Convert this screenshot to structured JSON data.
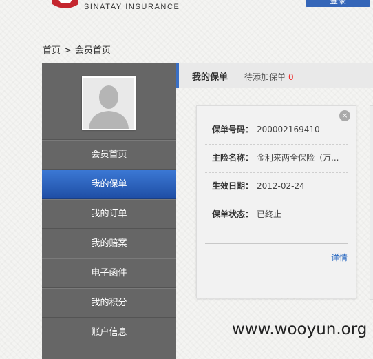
{
  "header": {
    "brand_en": "SINATAY INSURANCE",
    "login_label": "登录"
  },
  "breadcrumb": {
    "items": [
      "首页",
      "会员首页"
    ],
    "separator": ">"
  },
  "sidebar": {
    "items": [
      {
        "label": "会员首页",
        "active": false
      },
      {
        "label": "我的保单",
        "active": true
      },
      {
        "label": "我的订单",
        "active": false
      },
      {
        "label": "我的赔案",
        "active": false
      },
      {
        "label": "电子函件",
        "active": false
      },
      {
        "label": "我的积分",
        "active": false
      },
      {
        "label": "账户信息",
        "active": false
      }
    ]
  },
  "tabs": {
    "main": "我的保单",
    "sub": "待添加保单",
    "sub_count": "0"
  },
  "policy_card": {
    "close_icon": "×",
    "rows": [
      {
        "label": "保单号码：",
        "value": "200002169410"
      },
      {
        "label": "主险名称：",
        "value": "金利来两全保险（万..."
      },
      {
        "label": "生效日期：",
        "value": "2012-02-24"
      },
      {
        "label": "保单状态：",
        "value": "已终止"
      }
    ],
    "detail_link": "详情"
  },
  "watermark": "www.wooyun.org",
  "colors": {
    "accent": "#3566b8",
    "sidebar_bg": "#666666",
    "count_red": "#ee3333",
    "link": "#2c6bc2"
  }
}
